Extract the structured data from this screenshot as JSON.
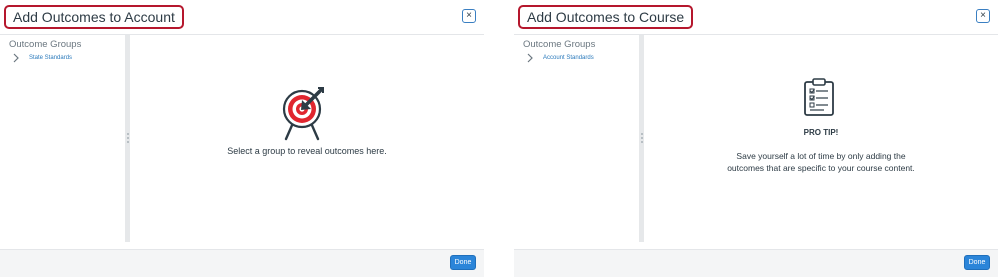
{
  "account_dialog": {
    "title": "Add Outcomes to Account",
    "close_label": "×",
    "sidebar": {
      "heading": "Outcome Groups",
      "items": [
        {
          "label": "State Standards"
        }
      ]
    },
    "empty_state": {
      "icon": "target-arrow-icon",
      "message": "Select a group to reveal outcomes here."
    },
    "footer": {
      "done_label": "Done"
    }
  },
  "course_dialog": {
    "title": "Add Outcomes to Course",
    "close_label": "×",
    "sidebar": {
      "heading": "Outcome Groups",
      "items": [
        {
          "label": "Account Standards"
        }
      ]
    },
    "pro_tip": {
      "icon": "clipboard-checklist-icon",
      "title": "PRO TIP!",
      "lines": [
        "Save yourself a lot of time by only adding the",
        "outcomes that are specific to your course content."
      ]
    },
    "footer": {
      "done_label": "Done"
    }
  },
  "colors": {
    "title_highlight": "#b5172d",
    "link": "#2b7abc",
    "primary_button": "#2b85d9",
    "splitter": "#e6e8ea"
  }
}
